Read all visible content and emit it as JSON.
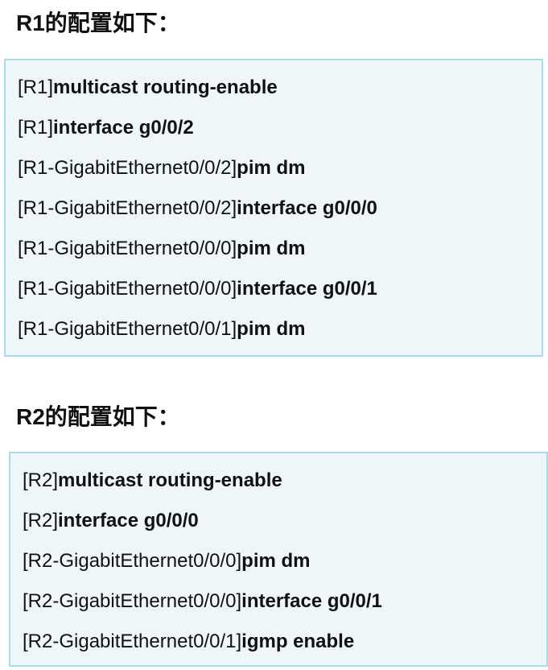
{
  "sections": [
    {
      "heading": "R1的配置如下：",
      "lines": [
        {
          "prompt": "[R1]",
          "command": "multicast routing-enable"
        },
        {
          "prompt": "[R1]",
          "command": "interface g0/0/2"
        },
        {
          "prompt": "[R1-GigabitEthernet0/0/2]",
          "command": "pim dm"
        },
        {
          "prompt": "[R1-GigabitEthernet0/0/2]",
          "command": "interface g0/0/0"
        },
        {
          "prompt": "[R1-GigabitEthernet0/0/0]",
          "command": "pim dm"
        },
        {
          "prompt": "[R1-GigabitEthernet0/0/0]",
          "command": "interface g0/0/1"
        },
        {
          "prompt": "[R1-GigabitEthernet0/0/1]",
          "command": "pim dm"
        }
      ]
    },
    {
      "heading": "R2的配置如下：",
      "lines": [
        {
          "prompt": "[R2]",
          "command": "multicast routing-enable"
        },
        {
          "prompt": "[R2]",
          "command": "interface g0/0/0"
        },
        {
          "prompt": "[R2-GigabitEthernet0/0/0]",
          "command": "pim dm"
        },
        {
          "prompt": "[R2-GigabitEthernet0/0/0]",
          "command": "interface g0/0/1"
        },
        {
          "prompt": "[R2-GigabitEthernet0/0/1]",
          "command": "igmp enable"
        }
      ]
    }
  ],
  "colors": {
    "box_background": "#eef6fa",
    "box_border": "#a8dcec",
    "text": "#111111"
  }
}
